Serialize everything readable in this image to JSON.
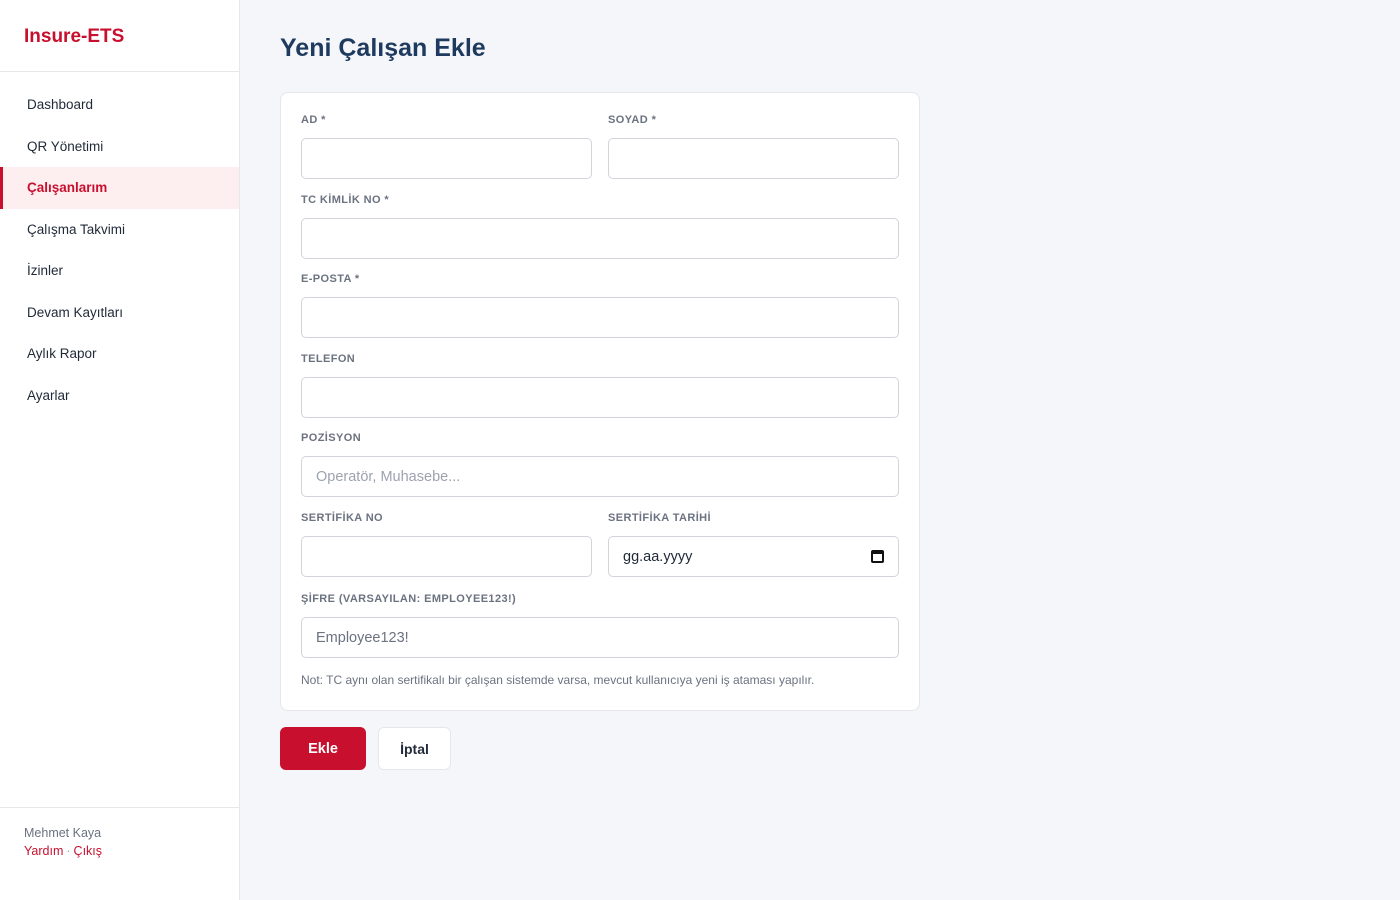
{
  "app": {
    "brand": "Insure-ETS"
  },
  "sidebar": {
    "items": [
      {
        "label": "Dashboard"
      },
      {
        "label": "QR Yönetimi"
      },
      {
        "label": "Çalışanlarım",
        "active": true
      },
      {
        "label": "Çalışma Takvimi"
      },
      {
        "label": "İzinler"
      },
      {
        "label": "Devam Kayıtları"
      },
      {
        "label": "Aylık Rapor"
      },
      {
        "label": "Ayarlar"
      }
    ],
    "footer": {
      "user_name": "Mehmet Kaya",
      "help_label": "Yardım",
      "separator": "·",
      "logout_label": "Çıkış"
    }
  },
  "page": {
    "title": "Yeni Çalışan Ekle"
  },
  "form": {
    "first_name": {
      "label": "AD *",
      "value": ""
    },
    "last_name": {
      "label": "SOYAD *",
      "value": ""
    },
    "tc_no": {
      "label": "TC KİMLİK NO *",
      "value": ""
    },
    "email": {
      "label": "E-POSTA *",
      "value": ""
    },
    "phone": {
      "label": "TELEFON",
      "value": ""
    },
    "position": {
      "label": "POZİSYON",
      "placeholder": "Operatör, Muhasebe..."
    },
    "cert_no": {
      "label": "SERTİFİKA NO",
      "value": ""
    },
    "cert_date": {
      "label": "SERTİFİKA TARİHİ",
      "placeholder": "gg.aa.yyyy"
    },
    "password": {
      "label": "ŞİFRE (VARSAYILAN: EMPLOYEE123!)",
      "value": "Employee123!"
    },
    "note": "Not: TC aynı olan sertifikalı bir çalışan sistemde varsa, mevcut kullanıcıya yeni iş ataması yapılır."
  },
  "actions": {
    "submit_label": "Ekle",
    "cancel_label": "İptal"
  },
  "colors": {
    "accent": "#c8102e",
    "title": "#1e3a5f",
    "active_bg": "#fdeef0"
  }
}
